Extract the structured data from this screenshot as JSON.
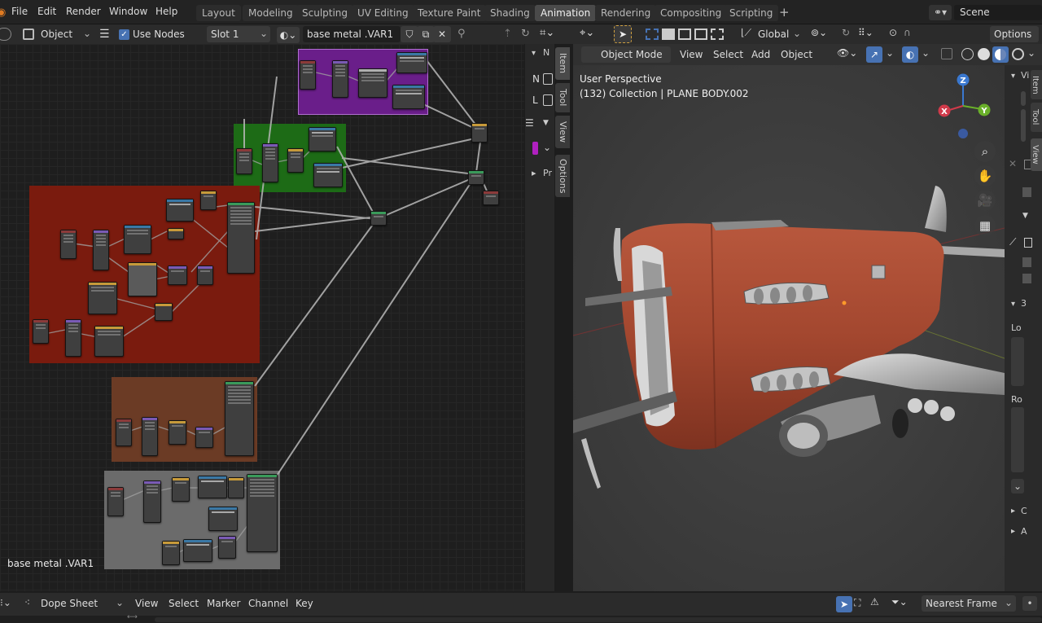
{
  "topbar": {
    "menus": [
      "File",
      "Edit",
      "Render",
      "Window",
      "Help"
    ],
    "workspaces": [
      "Layout",
      "Modeling",
      "Sculpting",
      "UV Editing",
      "Texture Paint",
      "Shading",
      "Animation",
      "Rendering",
      "Compositing",
      "Scripting"
    ],
    "active_workspace": "Animation",
    "add_workspace": "+",
    "scene_name": "Scene"
  },
  "node_header": {
    "object_label": "Object",
    "use_nodes_label": "Use Nodes",
    "slot_label": "Slot 1",
    "material_name": "base metal .VAR1"
  },
  "node_editor": {
    "material_overlay": "base metal .VAR1",
    "sidebar_letters": [
      "N",
      "L"
    ],
    "sidebar_tabs": [
      "Item",
      "Tool",
      "View",
      "Options"
    ],
    "panel_stub": "Pr"
  },
  "viewport_header": {
    "transform_orientation": "Global",
    "options_label": "Options",
    "mode_label": "Object Mode",
    "menus": [
      "View",
      "Select",
      "Add",
      "Object"
    ]
  },
  "viewport": {
    "perspective_label": "User Perspective",
    "collection_label": "(132) Collection | PLANE BODY.002",
    "gizmo": {
      "z": "Z",
      "x": "X",
      "y": "Y"
    },
    "side_tabs": [
      "Item",
      "Tool",
      "View"
    ],
    "side_labels": [
      "Vi",
      "3",
      "Lo",
      "Ro",
      "C",
      "A"
    ]
  },
  "dopesheet": {
    "editor_label": "Dope Sheet",
    "menus": [
      "View",
      "Select",
      "Marker",
      "Channel",
      "Key"
    ],
    "snap_label": "Nearest Frame"
  },
  "colors": {
    "accent_blue": "#4772b3",
    "frame_purple": "#6a1e8a",
    "frame_green": "#1d6b16",
    "frame_red": "#7a1b0e",
    "frame_brown": "#6b3b25",
    "frame_gray": "#6b6b6b",
    "plane_body": "#a84a33"
  }
}
